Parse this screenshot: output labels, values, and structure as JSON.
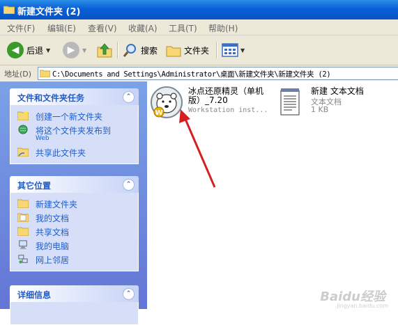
{
  "window": {
    "title": "新建文件夹 (2)",
    "title_icon": "folder-icon"
  },
  "menu": {
    "items": [
      "文件(F)",
      "编辑(E)",
      "查看(V)",
      "收藏(A)",
      "工具(T)",
      "帮助(H)"
    ]
  },
  "toolbar": {
    "back_label": "后退",
    "search_label": "搜索",
    "folders_label": "文件夹"
  },
  "address": {
    "label": "地址(D)",
    "value": "C:\\Documents and Settings\\Administrator\\桌面\\新建文件夹\\新建文件夹 (2)"
  },
  "panels": {
    "tasks": {
      "title": "文件和文件夹任务",
      "items": [
        {
          "label": "创建一个新文件夹",
          "icon": "new-folder-icon"
        },
        {
          "label": "将这个文件夹发布到",
          "sublabel": "Web",
          "icon": "globe-icon"
        },
        {
          "label": "共享此文件夹",
          "icon": "share-folder-icon"
        }
      ]
    },
    "places": {
      "title": "其它位置",
      "items": [
        {
          "label": "新建文件夹",
          "icon": "folder-icon"
        },
        {
          "label": "我的文档",
          "icon": "documents-icon"
        },
        {
          "label": "共享文档",
          "icon": "folder-icon"
        },
        {
          "label": "我的电脑",
          "icon": "computer-icon"
        },
        {
          "label": "网上邻居",
          "icon": "network-icon"
        }
      ]
    },
    "details": {
      "title": "详细信息"
    }
  },
  "files": [
    {
      "name_line1": "冰点还原精灵（单机",
      "name_line2": "版）_7.20",
      "sub": "Workstation inst...",
      "icon": "deepfreeze-bear-icon"
    },
    {
      "name_line1": "新建 文本文档",
      "sub1": "文本文档",
      "sub2": "1 KB",
      "icon": "text-document-icon"
    }
  ],
  "watermark": {
    "text": "Baidu经验",
    "sub": "jingyan.baidu.com"
  },
  "colors": {
    "title_blue": "#0a5fd6",
    "panel_blue": "#6f8fde",
    "link_blue": "#215dc6",
    "arrow_red": "#d62020"
  }
}
